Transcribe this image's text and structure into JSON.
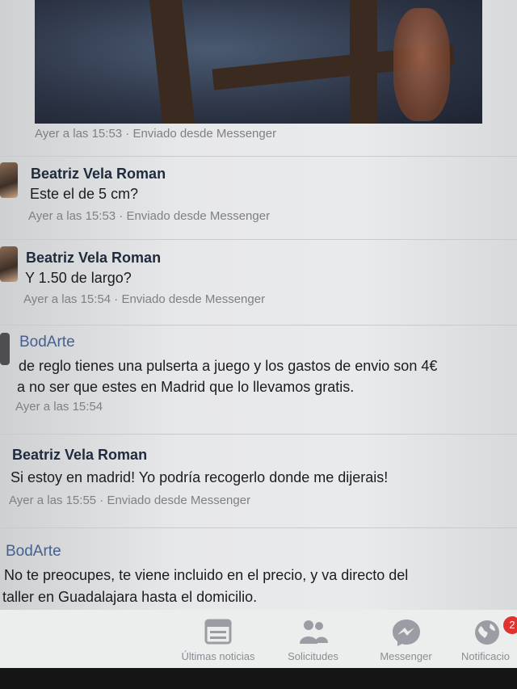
{
  "top_photo": {
    "timestamp": "Ayer a las 15:53 · Enviado desde Messenger"
  },
  "messages": [
    {
      "sender": "Beatriz Vela Roman",
      "text": "Este el de 5 cm?",
      "timestamp": "Ayer a las 15:53 · Enviado desde Messenger"
    },
    {
      "sender": "Beatriz Vela Roman",
      "text": "Y 1.50 de largo?",
      "timestamp": "Ayer a las 15:54 · Enviado desde Messenger"
    },
    {
      "sender": "BodArte",
      "text_line1": "de reglo tienes una pulserta a juego y los gastos de envio son 4€",
      "text_line2": "a no ser que estes en Madrid que lo llevamos gratis.",
      "timestamp": "Ayer a las 15:54"
    },
    {
      "sender": "Beatriz Vela Roman",
      "text": "Si estoy en madrid! Yo podría recogerlo donde me dijerais!",
      "timestamp": "Ayer a las 15:55 · Enviado desde Messenger"
    },
    {
      "sender": "BodArte",
      "text_line1": "No te preocupes, te viene incluido en el precio, y va directo del",
      "text_line2": "taller en Guadalajara hasta el domicilio."
    }
  ],
  "tabbar": {
    "tabs": [
      {
        "label": "Últimas noticias",
        "icon": "news-feed-icon"
      },
      {
        "label": "Solicitudes",
        "icon": "friend-requests-icon"
      },
      {
        "label": "Messenger",
        "icon": "messenger-icon"
      },
      {
        "label": "Notificacio",
        "icon": "globe-icon",
        "badge": "2"
      }
    ]
  },
  "colors": {
    "page_name": "#45618f",
    "meta": "#7d8086",
    "badge": "#e0322f"
  }
}
